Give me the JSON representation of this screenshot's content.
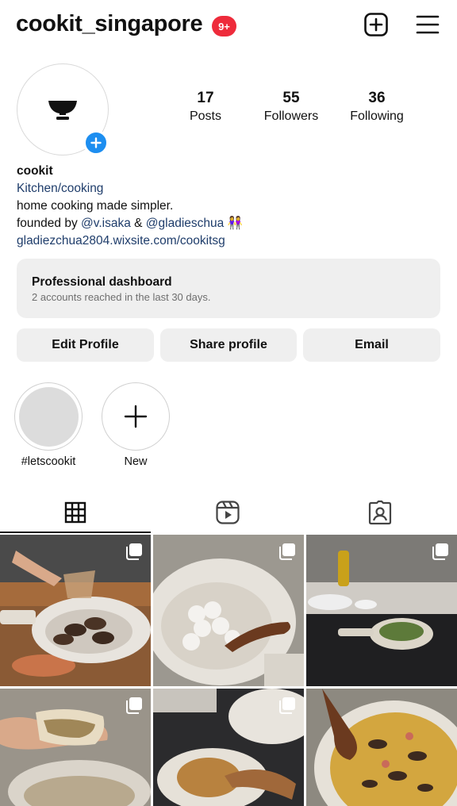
{
  "header": {
    "username": "cookit_singapore",
    "notification_badge": "9+"
  },
  "profile": {
    "stats": [
      {
        "value": "17",
        "label": "Posts"
      },
      {
        "value": "55",
        "label": "Followers"
      },
      {
        "value": "36",
        "label": "Following"
      }
    ],
    "name": "cookit",
    "category": "Kitchen/cooking",
    "bio_line1": "home cooking made simpler.",
    "bio_line2_prefix": "founded by ",
    "mention1": "@v.isaka",
    "bio_line2_mid": " & ",
    "mention2": "@gladieschua",
    "bio_line2_emoji": "👭",
    "website": "gladiezchua2804.wixsite.com/cookitsg"
  },
  "dashboard": {
    "title": "Professional dashboard",
    "subtitle": "2 accounts reached in the last 30 days."
  },
  "actions": {
    "edit": "Edit Profile",
    "share": "Share profile",
    "email": "Email"
  },
  "highlights": [
    {
      "label": "#letscookit"
    },
    {
      "label": "New"
    }
  ],
  "tabs": [
    {
      "icon": "grid-icon"
    },
    {
      "icon": "reels-icon"
    },
    {
      "icon": "tagged-icon"
    }
  ],
  "colors": {
    "accent_blue": "#1d8ef0",
    "badge_red": "#ee2b3b",
    "link_blue": "#1f3d6b",
    "button_gray": "#efefef"
  }
}
